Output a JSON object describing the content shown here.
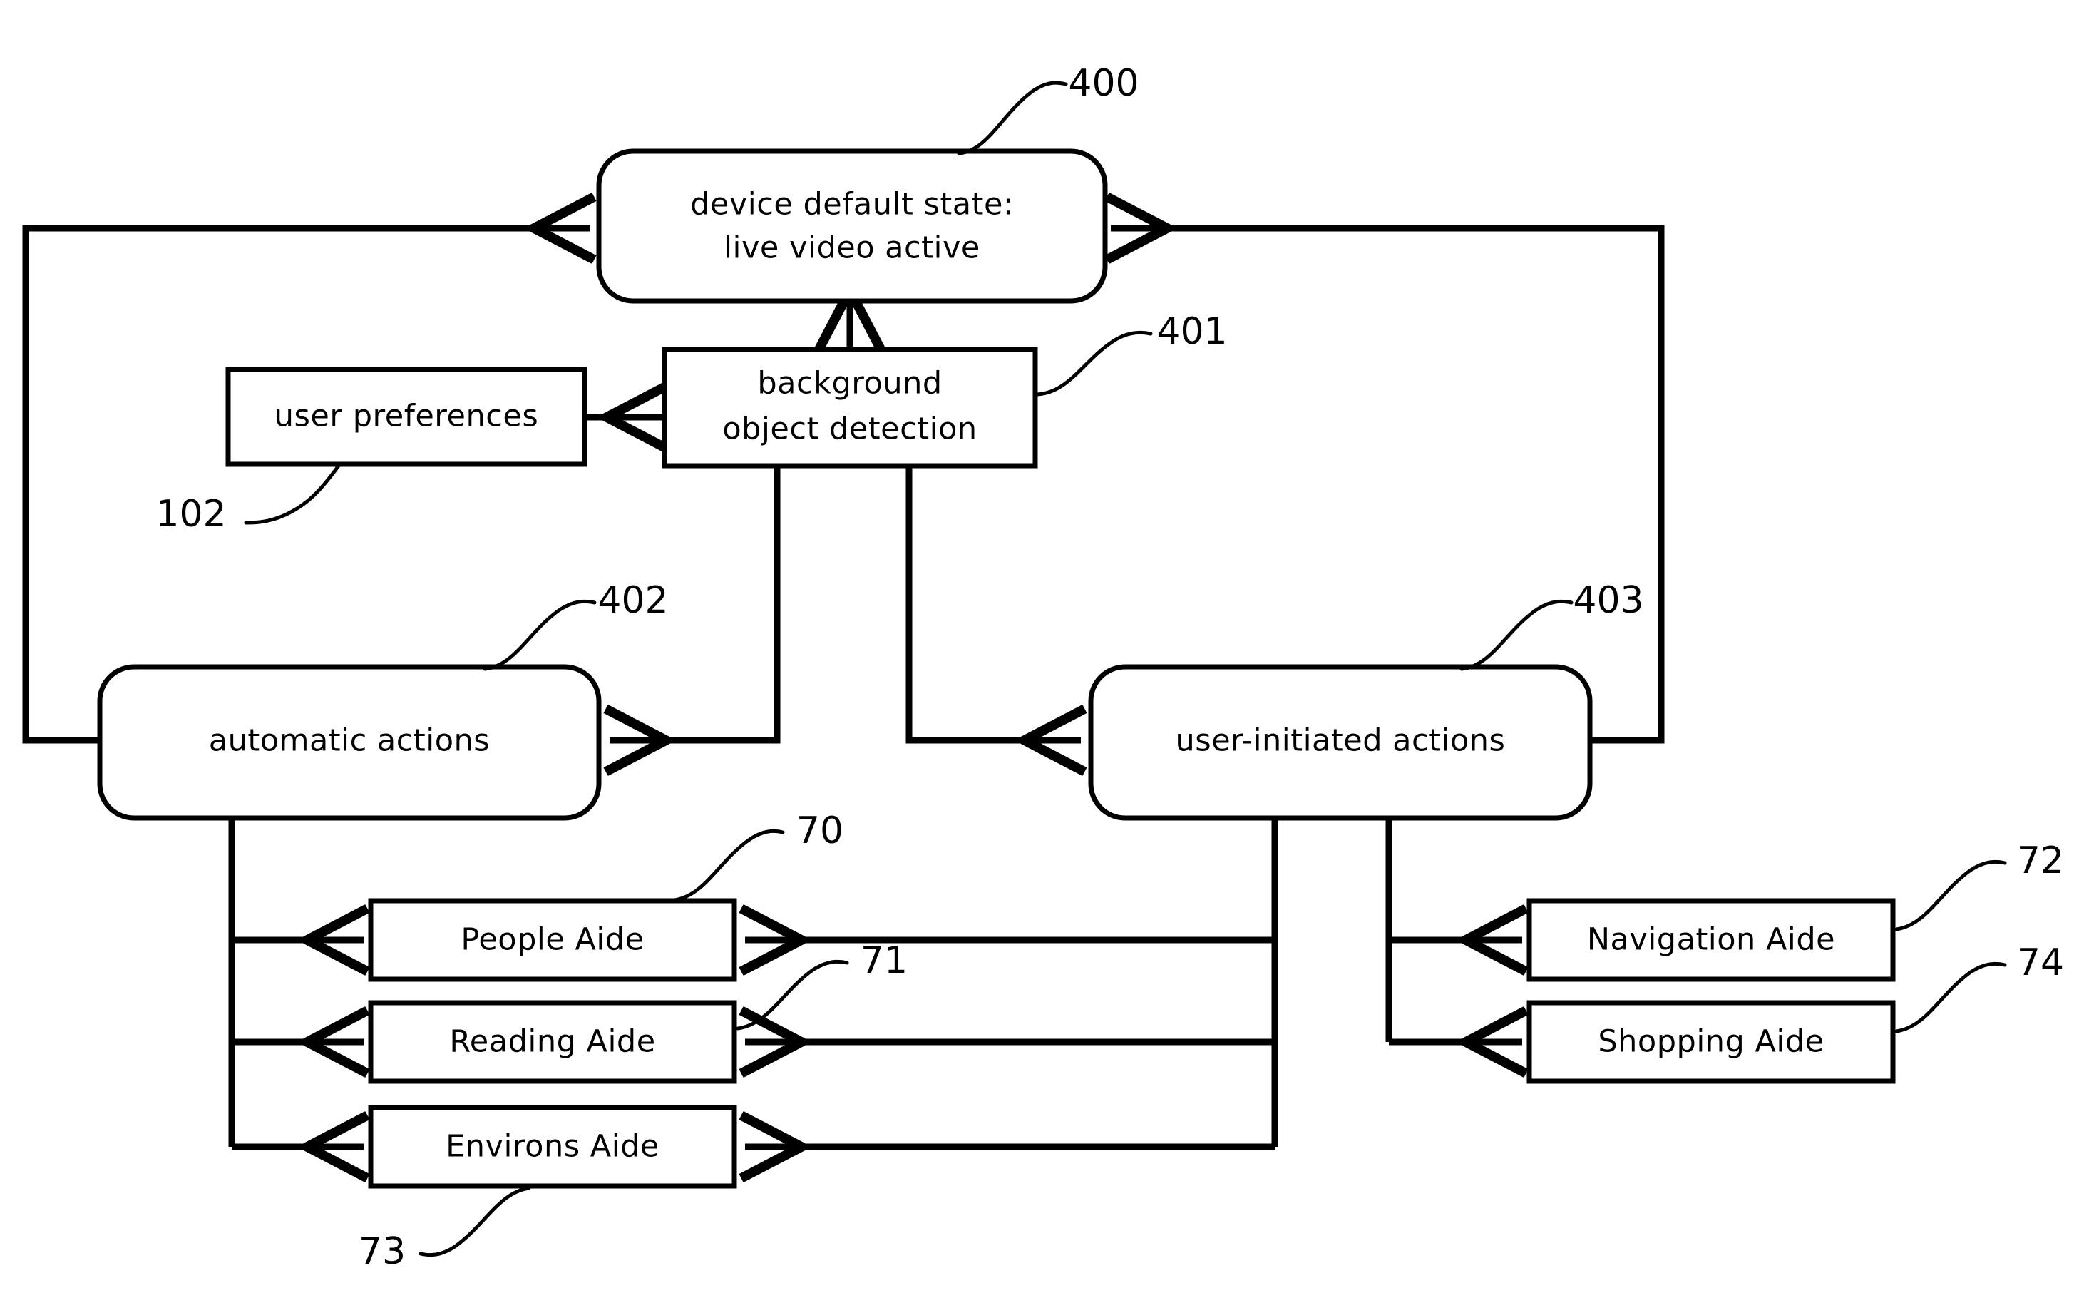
{
  "diagram": {
    "title": "device interaction state flow diagram",
    "stroke_color": "#000000",
    "background_color": "#ffffff",
    "nodes": [
      {
        "id": "default_state",
        "shape": "rounded-rectangle",
        "line1": "device default state:",
        "line2": "live video active",
        "ref": "400"
      },
      {
        "id": "user_preferences",
        "shape": "rectangle",
        "line1": "user preferences",
        "ref": "102"
      },
      {
        "id": "background_detection",
        "shape": "rectangle",
        "line1": "background",
        "line2": "object detection",
        "ref": "401"
      },
      {
        "id": "automatic_actions",
        "shape": "rounded-rectangle",
        "line1": "automatic actions",
        "ref": "402"
      },
      {
        "id": "user_initiated_actions",
        "shape": "rounded-rectangle",
        "line1": "user-initiated actions",
        "ref": "403"
      },
      {
        "id": "people_aide",
        "shape": "rectangle",
        "line1": "People Aide",
        "ref": "70"
      },
      {
        "id": "reading_aide",
        "shape": "rectangle",
        "line1": "Reading Aide",
        "ref": "71"
      },
      {
        "id": "environs_aide",
        "shape": "rectangle",
        "line1": "Environs Aide",
        "ref": "73"
      },
      {
        "id": "navigation_aide",
        "shape": "rectangle",
        "line1": "Navigation Aide",
        "ref": "72"
      },
      {
        "id": "shopping_aide",
        "shape": "rectangle",
        "line1": "Shopping Aide",
        "ref": "74"
      }
    ],
    "labels": {
      "default_state_line1": "device default state:",
      "default_state_line2": "live video active",
      "user_preferences": "user preferences",
      "background_detection_line1": "background",
      "background_detection_line2": "object detection",
      "automatic_actions": "automatic actions",
      "user_initiated_actions": "user-initiated actions",
      "people_aide": "People Aide",
      "reading_aide": "Reading Aide",
      "environs_aide": "Environs Aide",
      "navigation_aide": "Navigation Aide",
      "shopping_aide": "Shopping Aide"
    },
    "reference_numerals": {
      "default_state": "400",
      "background_detection": "401",
      "automatic_actions": "402",
      "user_initiated_actions": "403",
      "user_preferences": "102",
      "people_aide": "70",
      "reading_aide": "71",
      "navigation_aide": "72",
      "environs_aide": "73",
      "shopping_aide": "74"
    },
    "edges": [
      {
        "from": "default_state",
        "to": "background_detection",
        "direction": "down"
      },
      {
        "from": "user_preferences",
        "to": "background_detection",
        "direction": "right"
      },
      {
        "from": "background_detection",
        "to": "automatic_actions",
        "direction": "down-left"
      },
      {
        "from": "background_detection",
        "to": "user_initiated_actions",
        "direction": "down-right"
      },
      {
        "from": "automatic_actions",
        "to": "default_state",
        "direction": "left-up-right"
      },
      {
        "from": "user_initiated_actions",
        "to": "default_state",
        "direction": "right-up-left"
      },
      {
        "from": "automatic_actions",
        "to": "people_aide",
        "direction": "down-right"
      },
      {
        "from": "automatic_actions",
        "to": "reading_aide",
        "direction": "down-right"
      },
      {
        "from": "automatic_actions",
        "to": "environs_aide",
        "direction": "down-right"
      },
      {
        "from": "user_initiated_actions",
        "to": "people_aide",
        "direction": "down-left"
      },
      {
        "from": "user_initiated_actions",
        "to": "reading_aide",
        "direction": "down-left"
      },
      {
        "from": "user_initiated_actions",
        "to": "environs_aide",
        "direction": "down-left"
      },
      {
        "from": "user_initiated_actions",
        "to": "navigation_aide",
        "direction": "down-right"
      },
      {
        "from": "user_initiated_actions",
        "to": "shopping_aide",
        "direction": "down-right"
      }
    ]
  }
}
